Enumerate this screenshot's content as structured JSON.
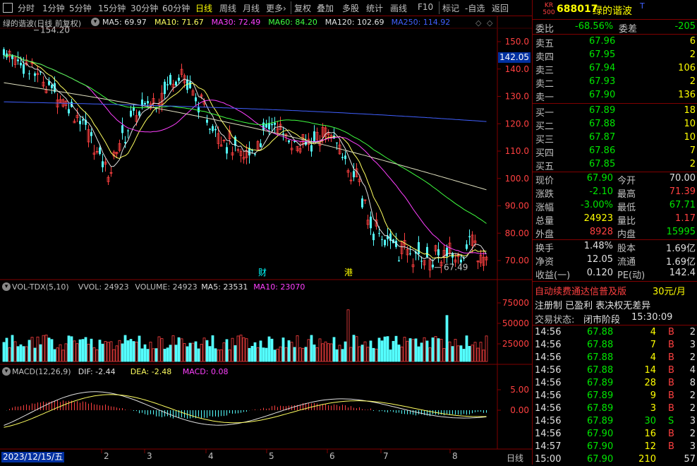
{
  "toolbar": {
    "items": [
      "分时",
      "1分钟",
      "5分钟",
      "15分钟",
      "30分钟",
      "60分钟",
      "日线",
      "周线",
      "月线",
      "更多›",
      "复权",
      "叠加",
      "多股",
      "统计",
      "画线",
      "F10",
      "标记",
      "-自选",
      "返回"
    ],
    "active": "日线"
  },
  "stock": {
    "code": "688017",
    "name": "绿的谐波",
    "badge_top": "KR",
    "badge_bottom": "500",
    "name_mark": "T"
  },
  "main_chart": {
    "title": "绿的谐波(日线 前复权)",
    "ma_labels": [
      {
        "text": "MA5: 69.97",
        "color": "#e0e0e0"
      },
      {
        "text": "MA10: 71.67",
        "color": "#ffff60"
      },
      {
        "text": "MA30: 72.49",
        "color": "#ff40ff"
      },
      {
        "text": "MA60: 84.20",
        "color": "#40ff40"
      },
      {
        "text": "MA120: 102.69",
        "color": "#e0e0e0"
      },
      {
        "text": "MA250: 114.92",
        "color": "#4060ff"
      }
    ],
    "y_ticks": [
      "150.0",
      "140.0",
      "130.0",
      "120.0",
      "110.0",
      "100.0",
      "90.00",
      "80.00",
      "70.00"
    ],
    "cursor_price": "142.05",
    "high_mark": "154.20",
    "low_mark": "67.49",
    "event_marks": [
      "财",
      "港"
    ]
  },
  "volume_chart": {
    "labels": [
      {
        "text": "VOL-TDX(5,10)",
        "color": "#c0c0c0"
      },
      {
        "text": "VVOL: 24923",
        "color": "#c0c0c0"
      },
      {
        "text": "VOLUME: 24923",
        "color": "#c0c0c0"
      },
      {
        "text": "MA5: 23531",
        "color": "#e0e0e0"
      },
      {
        "text": "MA10: 23070",
        "color": "#ff40ff"
      }
    ],
    "y_ticks": [
      "75000",
      "50000",
      "25000"
    ]
  },
  "macd_chart": {
    "labels": [
      {
        "text": "MACD(12,26,9)",
        "color": "#c0c0c0"
      },
      {
        "text": "DIF: -2.44",
        "color": "#e0e0e0"
      },
      {
        "text": "DEA: -2.48",
        "color": "#ffff60"
      },
      {
        "text": "MACD: 0.08",
        "color": "#ff40ff"
      }
    ],
    "y_ticks": [
      "5.00",
      "0.00"
    ]
  },
  "x_axis": {
    "date": "2023/12/15/五",
    "months": [
      "2",
      "3",
      "4",
      "5",
      "6",
      "7",
      "8"
    ],
    "period": "日线"
  },
  "order_book": {
    "weibi_label": "委比",
    "weibi": "-68.56%",
    "weicha_label": "委差",
    "weicha": "-205",
    "sells": [
      {
        "label": "卖五",
        "price": "67.96",
        "vol": "6"
      },
      {
        "label": "卖四",
        "price": "67.95",
        "vol": "2"
      },
      {
        "label": "卖三",
        "price": "67.94",
        "vol": "106"
      },
      {
        "label": "卖二",
        "price": "67.93",
        "vol": "2"
      },
      {
        "label": "卖一",
        "price": "67.90",
        "vol": "136"
      }
    ],
    "buys": [
      {
        "label": "买一",
        "price": "67.89",
        "vol": "18"
      },
      {
        "label": "买二",
        "price": "67.88",
        "vol": "10"
      },
      {
        "label": "买三",
        "price": "67.87",
        "vol": "10"
      },
      {
        "label": "买四",
        "price": "67.86",
        "vol": "7"
      },
      {
        "label": "买五",
        "price": "67.85",
        "vol": "2"
      }
    ]
  },
  "quote": [
    {
      "l1": "现价",
      "v1": "67.90",
      "c1": "g",
      "l2": "今开",
      "v2": "70.00",
      "c2": "w"
    },
    {
      "l1": "涨跌",
      "v1": "-2.10",
      "c1": "g",
      "l2": "最高",
      "v2": "71.39",
      "c2": "r"
    },
    {
      "l1": "涨幅",
      "v1": "-3.00%",
      "c1": "g",
      "l2": "最低",
      "v2": "67.71",
      "c2": "g"
    },
    {
      "l1": "总量",
      "v1": "24923",
      "c1": "y",
      "l2": "量比",
      "v2": "1.17",
      "c2": "r"
    },
    {
      "l1": "外盘",
      "v1": "8928",
      "c1": "r",
      "l2": "内盘",
      "v2": "15995",
      "c2": "g"
    }
  ],
  "fundamentals": [
    {
      "l1": "换手",
      "v1": "1.48%",
      "l2": "股本",
      "v2": "1.69亿"
    },
    {
      "l1": "净资",
      "v1": "12.05",
      "l2": "流通",
      "v2": "1.69亿"
    },
    {
      "l1": "收益(一)",
      "v1": "0.120",
      "l2": "PE(动)",
      "v2": "142.4"
    }
  ],
  "ad_text": "自动续费通达信普及版",
  "ad_price": "30元/月",
  "info_line": "注册制 已盈利 表决权无差异",
  "status_label": "交易状态:",
  "status_value": "闭市阶段",
  "status_time": "15:30:09",
  "ticks": [
    {
      "time": "14:56",
      "price": "67.88",
      "vol": "4",
      "side": "B",
      "n": "2"
    },
    {
      "time": "14:56",
      "price": "67.88",
      "vol": "7",
      "side": "B",
      "n": "3"
    },
    {
      "time": "14:56",
      "price": "67.88",
      "vol": "4",
      "side": "B",
      "n": "2"
    },
    {
      "time": "14:56",
      "price": "67.88",
      "vol": "14",
      "side": "B",
      "n": "4"
    },
    {
      "time": "14:56",
      "price": "67.89",
      "vol": "28",
      "side": "B",
      "n": "8"
    },
    {
      "time": "14:56",
      "price": "67.89",
      "vol": "9",
      "side": "B",
      "n": "2"
    },
    {
      "time": "14:56",
      "price": "67.89",
      "vol": "3",
      "side": "B",
      "n": "2"
    },
    {
      "time": "14:56",
      "price": "67.89",
      "vol": "30",
      "side": "S",
      "n": "3"
    },
    {
      "time": "14:56",
      "price": "67.90",
      "vol": "16",
      "side": "B",
      "n": "2"
    },
    {
      "time": "14:57",
      "price": "67.90",
      "vol": "12",
      "side": "B",
      "n": "3"
    },
    {
      "time": "15:00",
      "price": "67.90",
      "vol": "210",
      "side": "",
      "n": "57"
    }
  ]
}
